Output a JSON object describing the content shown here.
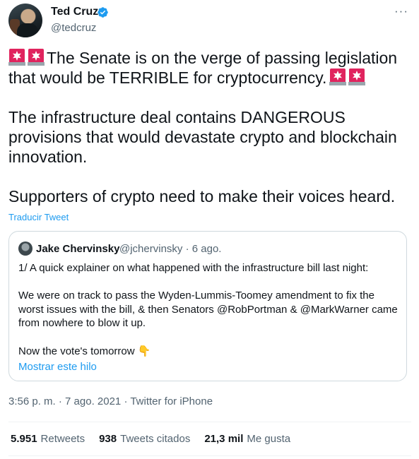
{
  "author": {
    "name": "Ted Cruz",
    "handle": "@tedcruz",
    "verified": true,
    "avatar_icon": "profile-photo"
  },
  "more_icon": "···",
  "tweet": {
    "line1": "The Senate is on the verge of passing legislation",
    "line2": "would be TERRIBLE for cryptocurrency.",
    "line2_prefix": "that ",
    "para2": "The infrastructure deal contains DANGEROUS\nprovisions that would devastate crypto and blockchain\ninnovation.",
    "para3": "Supporters of crypto need to make their voices heard.",
    "emoji": "rotating-light-siren"
  },
  "translate_label": "Traducir Tweet",
  "quoted": {
    "name": "Jake Chervinsky",
    "handle_time": "@jchervinsky · 6 ago.",
    "p1": "1/ A quick explainer on what happened with the infrastructure bill last night:",
    "p2": "We were on track to pass the Wyden-Lummis-Toomey amendment to fix the worst issues with the bill, & then Senators @RobPortman & @MarkWarner came from nowhere to blow it up.",
    "p3": "Now the vote's tomorrow 👇",
    "show_thread": "Mostrar este hilo"
  },
  "meta": "3:56 p. m. · 7 ago. 2021 · Twitter for iPhone",
  "stats": {
    "retweets_count": "5.951",
    "retweets_label": "Retweets",
    "quotes_count": "938",
    "quotes_label": "Tweets citados",
    "likes_count": "21,3 mil",
    "likes_label": "Me gusta"
  },
  "colors": {
    "accent": "#1d9bf0",
    "text": "#0f1419",
    "secondary": "#536471",
    "siren_red": "#e0245e"
  }
}
